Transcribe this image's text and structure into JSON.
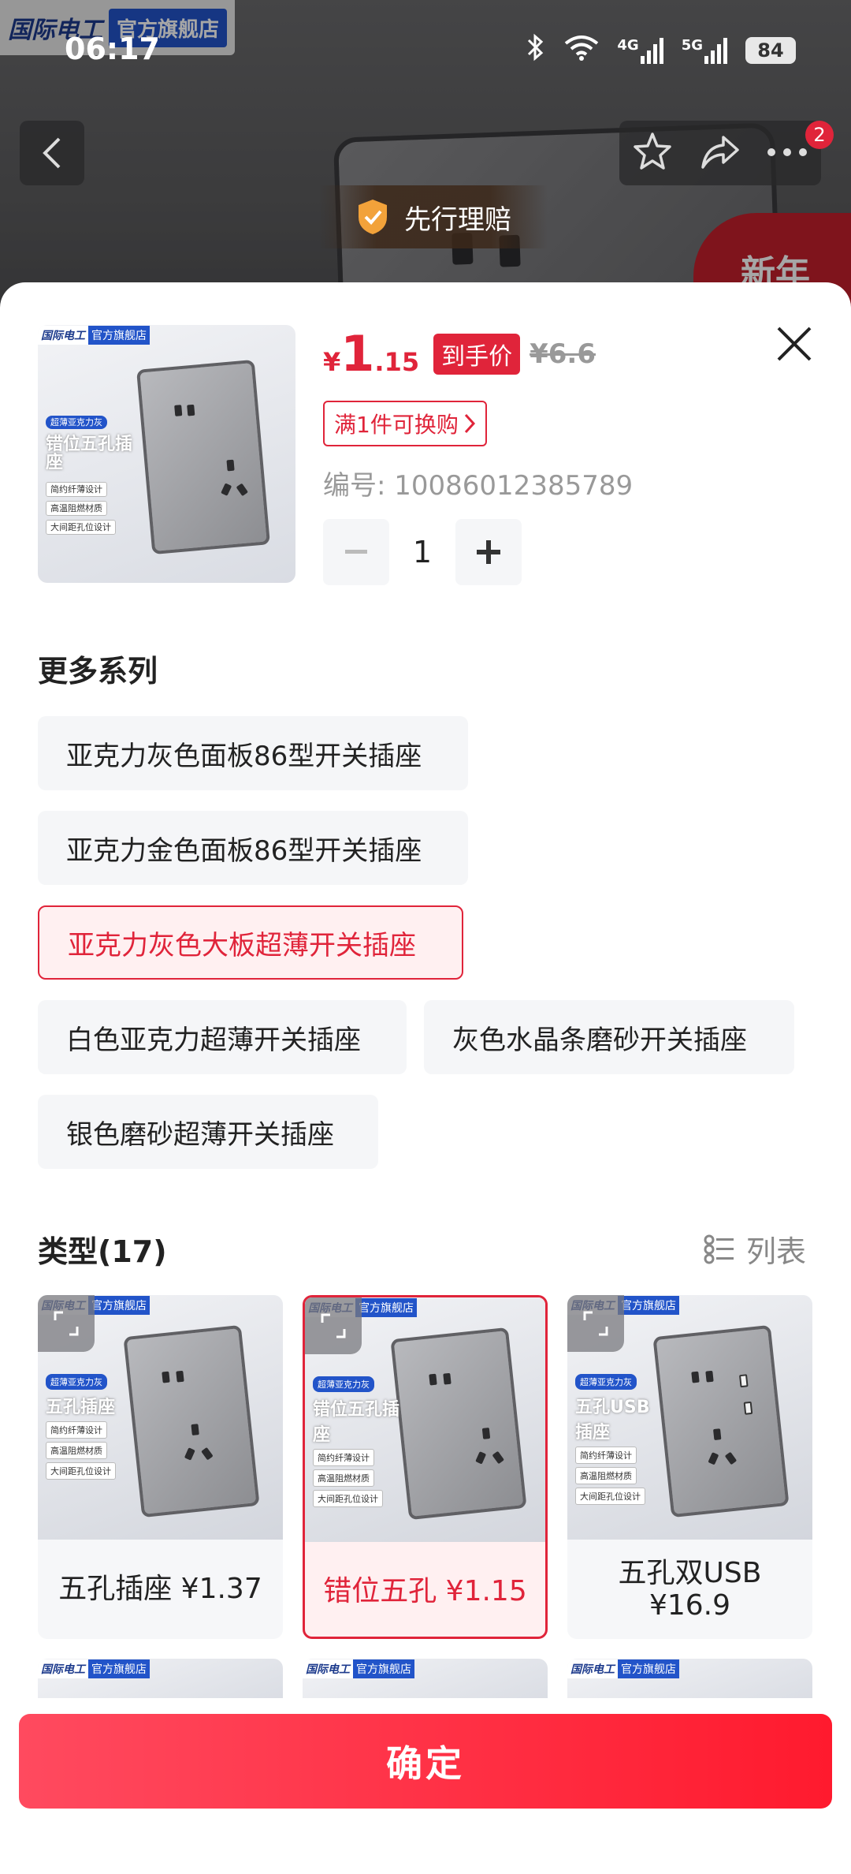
{
  "status_bar": {
    "time": "06:17",
    "network_4g": "4G",
    "network_5g": "5G",
    "battery": "84"
  },
  "background": {
    "shop_brand": "国际电工",
    "shop_tag": "官方旗舰店",
    "claim_badge": "先行理赔",
    "cart_count": "2",
    "promo_text": "新年"
  },
  "product": {
    "price_symbol": "¥",
    "price_integer": "1",
    "price_decimal": ".15",
    "final_price_tag": "到手价",
    "original_price": "¥6.6",
    "coupon_label": "满1件可换购",
    "sku_code": "编号: 10086012385789",
    "quantity": "1",
    "thumb": {
      "brand": "国际电工",
      "tag": "官方旗舰店",
      "series": "超薄亚克力灰",
      "title": "错位五孔插座",
      "feature_1": "简约纤薄设计",
      "feature_2": "高温阻燃材质",
      "feature_3": "大间距孔位设计"
    }
  },
  "series": {
    "title": "更多系列",
    "items": [
      {
        "label": "亚克力灰色面板86型开关插座",
        "selected": false
      },
      {
        "label": "亚克力金色面板86型开关插座",
        "selected": false
      },
      {
        "label": "亚克力灰色大板超薄开关插座",
        "selected": true
      },
      {
        "label": "白色亚克力超薄开关插座",
        "selected": false
      },
      {
        "label": "灰色水晶条磨砂开关插座",
        "selected": false
      },
      {
        "label": "银色磨砂超薄开关插座",
        "selected": false
      }
    ]
  },
  "types": {
    "title": "类型(17)",
    "view_toggle": "列表",
    "items": [
      {
        "label": "五孔插座 ¥1.37",
        "image_title": "五孔插座",
        "selected": false
      },
      {
        "label": "错位五孔 ¥1.15",
        "image_title": "错位五孔插座",
        "selected": true
      },
      {
        "label": "五孔双USB ¥16.9",
        "image_title": "五孔USB插座",
        "selected": false
      }
    ],
    "image_series": "超薄亚克力灰",
    "image_feature_1": "简约纤薄设计",
    "image_feature_2": "高温阻燃材质",
    "image_feature_3": "大间距孔位设计",
    "image_brand": "国际电工",
    "image_tag": "官方旗舰店"
  },
  "confirm_label": "确定",
  "colors": {
    "accent": "#e0243a",
    "confirm_start": "#ff4a5f",
    "confirm_end": "#ff1a2e"
  }
}
